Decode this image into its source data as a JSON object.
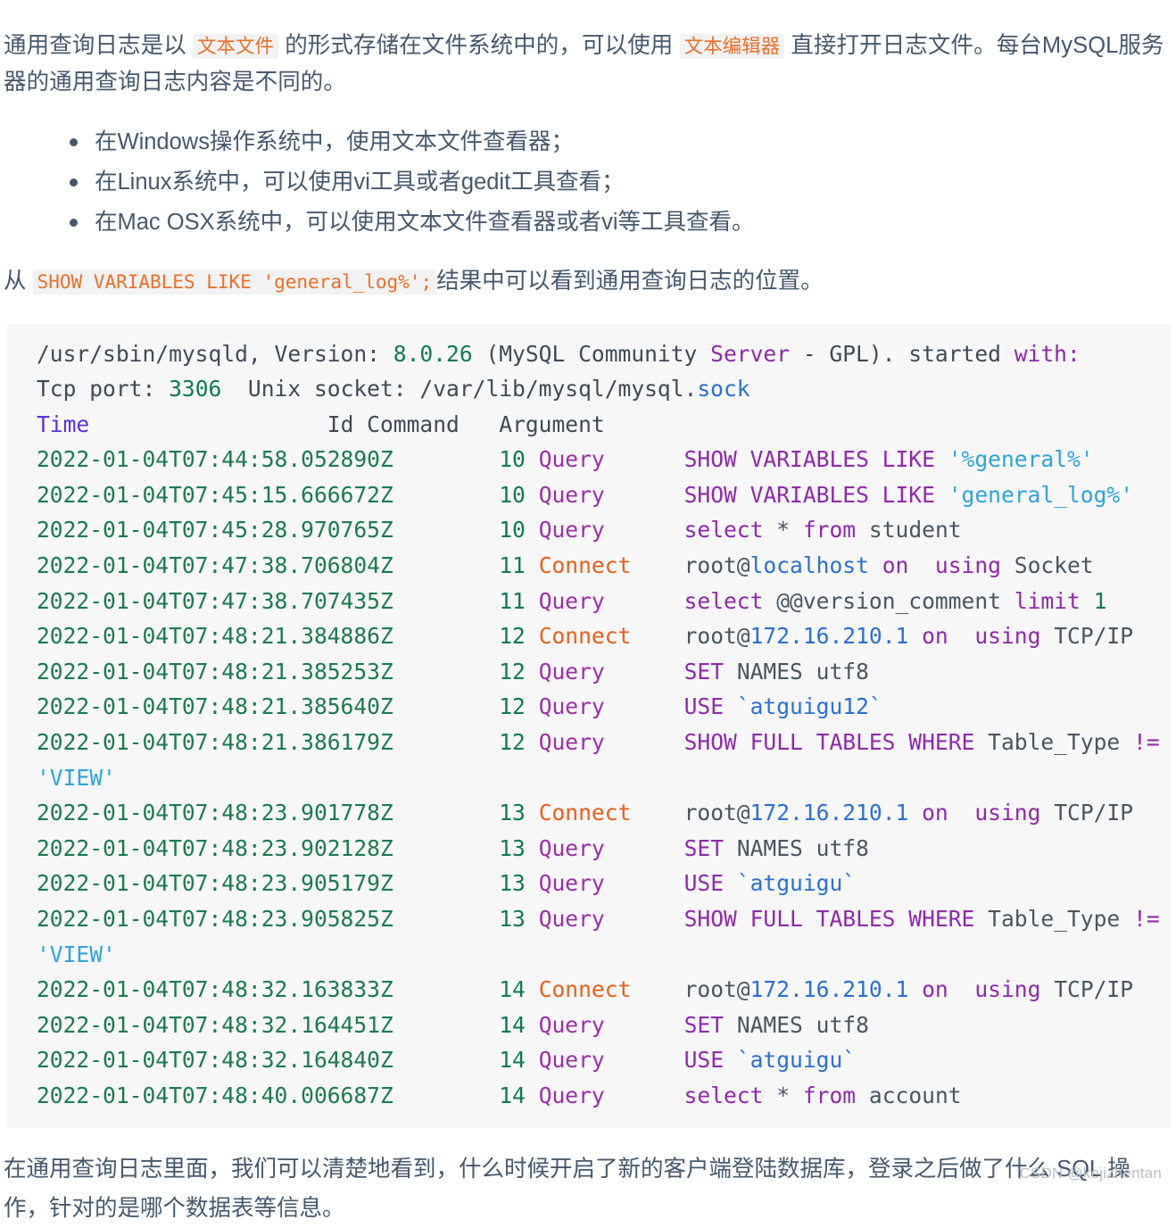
{
  "intro": {
    "part1": "通用查询日志是以 ",
    "code1": "文本文件",
    "part2": " 的形式存储在文件系统中的，可以使用 ",
    "code2": "文本编辑器",
    "part3": " 直接打开日志文件。每台MySQL服务器的通用查询日志内容是不同的。"
  },
  "bullets": [
    "在Windows操作系统中，使用文本文件查看器；",
    "在Linux系统中，可以使用vi工具或者gedit工具查看；",
    "在Mac OSX系统中，可以使用文本文件查看器或者vi等工具查看。"
  ],
  "lead": {
    "prefix": "从 ",
    "code": "SHOW VARIABLES LIKE 'general_log%';",
    "suffix": "结果中可以看到通用查询日志的位置。"
  },
  "code_block": {
    "header": {
      "path": "/usr/sbin/mysqld,",
      "version_label": " Version: ",
      "version": "8.0.26",
      "paren_open": " (MySQL Community ",
      "server": "Server",
      "dash": " - GPL). ",
      "started": "started",
      "with": " with:",
      "tcp_label": "Tcp port: ",
      "tcp_port": "3306",
      "socket_label": "  Unix socket: /var/lib/mysql/mysql.",
      "socket_ext": "sock",
      "col_time": "Time",
      "col_id": "Id Command",
      "col_arg": "Argument"
    },
    "rows": [
      {
        "time": "2022-01-04T07:44:58.052890Z",
        "id": "10",
        "command": "Query",
        "command_type": "query",
        "argument": "SHOW VARIABLES LIKE '%general%'",
        "arg_tokens": [
          {
            "t": "SHOW VARIABLES LIKE ",
            "c": "kw"
          },
          {
            "t": "'%general%'",
            "c": "str"
          }
        ]
      },
      {
        "time": "2022-01-04T07:45:15.666672Z",
        "id": "10",
        "command": "Query",
        "command_type": "query",
        "argument": "SHOW VARIABLES LIKE 'general_log%'",
        "arg_tokens": [
          {
            "t": "SHOW VARIABLES LIKE ",
            "c": "kw"
          },
          {
            "t": "'general_log%'",
            "c": "str"
          }
        ]
      },
      {
        "time": "2022-01-04T07:45:28.970765Z",
        "id": "10",
        "command": "Query",
        "command_type": "query",
        "argument": "select * from student",
        "arg_tokens": [
          {
            "t": "select ",
            "c": "kw"
          },
          {
            "t": "* ",
            "c": "grey"
          },
          {
            "t": "from ",
            "c": "kw"
          },
          {
            "t": "student",
            "c": "grey"
          }
        ]
      },
      {
        "time": "2022-01-04T07:47:38.706804Z",
        "id": "11",
        "command": "Connect",
        "command_type": "connect",
        "argument": "root@localhost on  using Socket",
        "arg_tokens": [
          {
            "t": "root@",
            "c": "grey"
          },
          {
            "t": "localhost",
            "c": "host"
          },
          {
            "t": " on ",
            "c": "kw"
          },
          {
            "t": " using ",
            "c": "kw"
          },
          {
            "t": "Socket",
            "c": "grey"
          }
        ]
      },
      {
        "time": "2022-01-04T07:47:38.707435Z",
        "id": "11",
        "command": "Query",
        "command_type": "query",
        "argument": "select @@version_comment limit 1",
        "arg_tokens": [
          {
            "t": "select ",
            "c": "kw"
          },
          {
            "t": "@@version_comment ",
            "c": "grey"
          },
          {
            "t": "limit ",
            "c": "kw"
          },
          {
            "t": "1",
            "c": "num"
          }
        ]
      },
      {
        "time": "2022-01-04T07:48:21.384886Z",
        "id": "12",
        "command": "Connect",
        "command_type": "connect",
        "argument": "root@172.16.210.1 on  using TCP/IP",
        "arg_tokens": [
          {
            "t": "root@",
            "c": "grey"
          },
          {
            "t": "172.16.210.1",
            "c": "host"
          },
          {
            "t": " on ",
            "c": "kw"
          },
          {
            "t": " using ",
            "c": "kw"
          },
          {
            "t": "TCP/IP",
            "c": "grey"
          }
        ]
      },
      {
        "time": "2022-01-04T07:48:21.385253Z",
        "id": "12",
        "command": "Query",
        "command_type": "query",
        "argument": "SET NAMES utf8",
        "arg_tokens": [
          {
            "t": "SET ",
            "c": "kw"
          },
          {
            "t": "NAMES utf8",
            "c": "grey"
          }
        ]
      },
      {
        "time": "2022-01-04T07:48:21.385640Z",
        "id": "12",
        "command": "Query",
        "command_type": "query",
        "argument": "USE `atguigu12`",
        "arg_tokens": [
          {
            "t": "USE ",
            "c": "kw"
          },
          {
            "t": "`atguigu12`",
            "c": "host"
          }
        ]
      },
      {
        "time": "2022-01-04T07:48:21.386179Z",
        "id": "12",
        "command": "Query",
        "command_type": "query",
        "argument": "SHOW FULL TABLES WHERE Table_Type != 'VIEW'",
        "arg_tokens": [
          {
            "t": "SHOW FULL TABLES WHERE ",
            "c": "kw"
          },
          {
            "t": "Table_Type ",
            "c": "grey"
          },
          {
            "t": "!= ",
            "c": "kw"
          },
          {
            "t": "'VIEW'",
            "c": "str"
          }
        ]
      },
      {
        "time": "2022-01-04T07:48:23.901778Z",
        "id": "13",
        "command": "Connect",
        "command_type": "connect",
        "argument": "root@172.16.210.1 on  using TCP/IP",
        "arg_tokens": [
          {
            "t": "root@",
            "c": "grey"
          },
          {
            "t": "172.16.210.1",
            "c": "host"
          },
          {
            "t": " on ",
            "c": "kw"
          },
          {
            "t": " using ",
            "c": "kw"
          },
          {
            "t": "TCP/IP",
            "c": "grey"
          }
        ]
      },
      {
        "time": "2022-01-04T07:48:23.902128Z",
        "id": "13",
        "command": "Query",
        "command_type": "query",
        "argument": "SET NAMES utf8",
        "arg_tokens": [
          {
            "t": "SET ",
            "c": "kw"
          },
          {
            "t": "NAMES utf8",
            "c": "grey"
          }
        ]
      },
      {
        "time": "2022-01-04T07:48:23.905179Z",
        "id": "13",
        "command": "Query",
        "command_type": "query",
        "argument": "USE `atguigu`",
        "arg_tokens": [
          {
            "t": "USE ",
            "c": "kw"
          },
          {
            "t": "`atguigu`",
            "c": "host"
          }
        ]
      },
      {
        "time": "2022-01-04T07:48:23.905825Z",
        "id": "13",
        "command": "Query",
        "command_type": "query",
        "argument": "SHOW FULL TABLES WHERE Table_Type != 'VIEW'",
        "arg_tokens": [
          {
            "t": "SHOW FULL TABLES WHERE ",
            "c": "kw"
          },
          {
            "t": "Table_Type ",
            "c": "grey"
          },
          {
            "t": "!= ",
            "c": "kw"
          },
          {
            "t": "'VIEW'",
            "c": "str"
          }
        ]
      },
      {
        "time": "2022-01-04T07:48:32.163833Z",
        "id": "14",
        "command": "Connect",
        "command_type": "connect",
        "argument": "root@172.16.210.1 on  using TCP/IP",
        "arg_tokens": [
          {
            "t": "root@",
            "c": "grey"
          },
          {
            "t": "172.16.210.1",
            "c": "host"
          },
          {
            "t": " on ",
            "c": "kw"
          },
          {
            "t": " using ",
            "c": "kw"
          },
          {
            "t": "TCP/IP",
            "c": "grey"
          }
        ]
      },
      {
        "time": "2022-01-04T07:48:32.164451Z",
        "id": "14",
        "command": "Query",
        "command_type": "query",
        "argument": "SET NAMES utf8",
        "arg_tokens": [
          {
            "t": "SET ",
            "c": "kw"
          },
          {
            "t": "NAMES utf8",
            "c": "grey"
          }
        ]
      },
      {
        "time": "2022-01-04T07:48:32.164840Z",
        "id": "14",
        "command": "Query",
        "command_type": "query",
        "argument": "USE `atguigu`",
        "arg_tokens": [
          {
            "t": "USE ",
            "c": "kw"
          },
          {
            "t": "`atguigu`",
            "c": "host"
          }
        ]
      },
      {
        "time": "2022-01-04T07:48:40.006687Z",
        "id": "14",
        "command": "Query",
        "command_type": "query",
        "argument": "select * from account",
        "arg_tokens": [
          {
            "t": "select ",
            "c": "kw"
          },
          {
            "t": "* ",
            "c": "grey"
          },
          {
            "t": "from ",
            "c": "kw"
          },
          {
            "t": "account",
            "c": "grey"
          }
        ]
      }
    ]
  },
  "outro": "在通用查询日志里面，我们可以清楚地看到，什么时候开启了新的客户端登陆数据库，登录之后做了什么 SQL 操作，针对的是哪个数据表等信息。",
  "watermark": "CSDN @kejizhentan",
  "colors": {
    "body_text": "#45586c",
    "inline_code": "#e8702a",
    "code_bg": "#f7f7f8",
    "timestamp": "#1b7a4f",
    "connect": "#e8601c",
    "query": "#9b2fa5",
    "keyword": "#8e2aa8",
    "string": "#2ca5d8",
    "identifier": "#2b6fd0",
    "header_col": "#5a2fe0",
    "watermark": "#b9c0c7"
  }
}
